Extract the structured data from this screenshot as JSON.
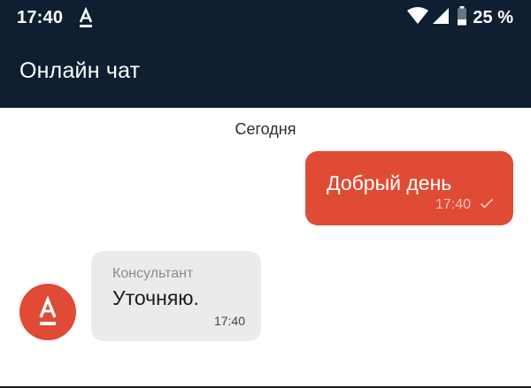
{
  "status_bar": {
    "time": "17:40",
    "notification_icon": "alfa-bank-logo-icon",
    "wifi_icon": "wifi-icon",
    "signal_icon": "cell-signal-icon",
    "battery_icon": "battery-icon",
    "battery_percent": "25 %"
  },
  "app_bar": {
    "title": "Онлайн чат"
  },
  "chat": {
    "date_divider": "Сегодня",
    "messages": [
      {
        "direction": "outgoing",
        "text": "Добрый день",
        "time": "17:40",
        "status_icon": "check-icon"
      },
      {
        "direction": "incoming",
        "sender": "Консультант",
        "text": "Уточняю.",
        "time": "17:40",
        "avatar_icon": "alfa-bank-logo-icon"
      }
    ]
  },
  "colors": {
    "header_bg": "#0f1e30",
    "accent": "#e04b35",
    "incoming_bubble": "#ebebeb"
  }
}
